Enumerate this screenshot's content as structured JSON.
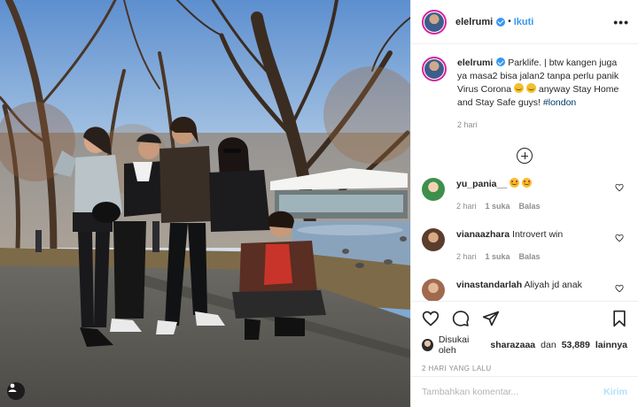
{
  "photo": {
    "alt_label": "",
    "tag_icon": "user-tag-icon"
  },
  "header": {
    "username": "elelrumi",
    "separator": "•",
    "follow_label": "Ikuti",
    "more_label": "•••"
  },
  "caption": {
    "username": "elelrumi",
    "text_1": "Parklife. | btw kangen juga ya masa2 bisa jalan2 tanpa perlu panik Virus Corona",
    "text_2": "anyway Stay Home and Stay Safe guys!",
    "hashtag": "#london",
    "time": "2 hari"
  },
  "comments": [
    {
      "username": "yu_pania__",
      "text": "",
      "emoji": "heart-eyes",
      "time": "2 hari",
      "likes": "1 suka",
      "reply": "Balas",
      "avatar_color": "#3e8f4c"
    },
    {
      "username": "vianaazhara",
      "text": "Introvert win",
      "emoji": "",
      "time": "2 hari",
      "likes": "1 suka",
      "reply": "Balas",
      "avatar_color": "#5a3d2c"
    },
    {
      "username": "vinastandarlah",
      "text": "Aliyah jd anak",
      "emoji": "",
      "time": "",
      "likes": "",
      "reply": "",
      "avatar_color": "#a06a4e"
    }
  ],
  "likes": {
    "prefix": "Disukai oleh",
    "first_user": "sharazaaa",
    "conjunction": "dan",
    "count": "53,889",
    "suffix": "lainnya"
  },
  "post_date": "2 HARI YANG LALU",
  "comment_box": {
    "placeholder": "Tambahkan komentar...",
    "post_label": "Kirim"
  },
  "colors": {
    "accent": "#3897f0",
    "muted": "#8e8e8e",
    "border": "#efefef",
    "post_disabled": "#b2dffc"
  }
}
